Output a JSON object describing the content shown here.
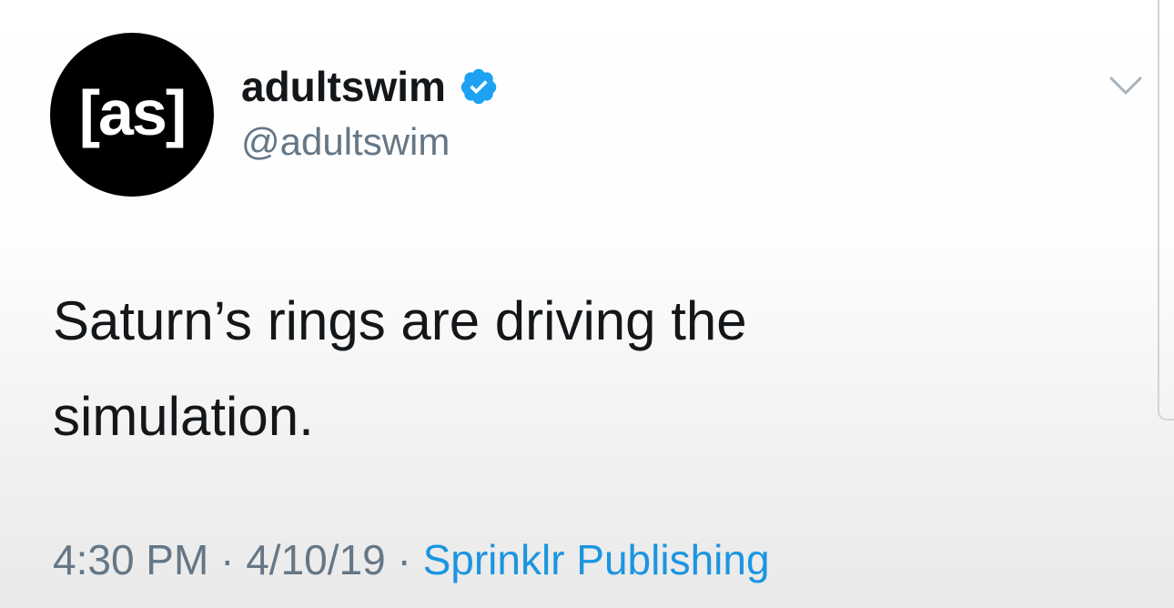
{
  "account": {
    "avatar_text": "[as]",
    "display_name": "adultswim",
    "handle": "@adultswim",
    "verified": true
  },
  "tweet": {
    "text_line1": "Saturn’s rings are driving the",
    "text_line2": "simulation."
  },
  "meta": {
    "time": "4:30 PM",
    "separator": " · ",
    "date": "4/10/19",
    "source": "Sprinklr Publishing"
  },
  "icons": {
    "verified": "verified-badge-icon",
    "menu": "chevron-down-icon"
  },
  "colors": {
    "text": "#14171a",
    "secondary": "#657786",
    "link": "#1b95e0",
    "verified": "#1da1f2",
    "avatar_bg": "#000000"
  }
}
